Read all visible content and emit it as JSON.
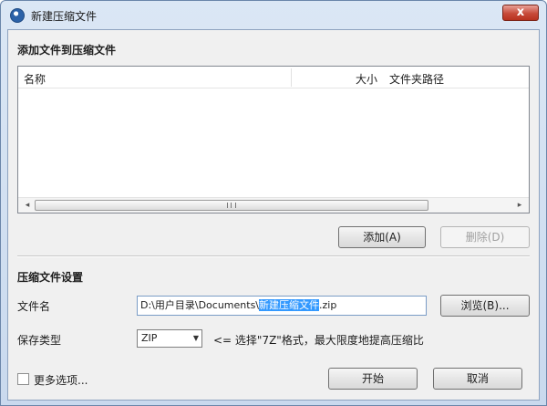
{
  "window": {
    "title": "新建压缩文件",
    "close_glyph": "x"
  },
  "add_section": {
    "heading": "添加文件到压缩文件",
    "columns": {
      "name": "名称",
      "size": "大小",
      "path": "文件夹路径"
    },
    "scroll_left": "◂",
    "scroll_right": "▸",
    "add_button": "添加(A)",
    "delete_button": "删除(D)"
  },
  "settings_section": {
    "heading": "压缩文件设置",
    "filename_label": "文件名",
    "filename_prefix": "D:\\用户目录\\Documents\\",
    "filename_selected": "新建压缩文件",
    "filename_suffix": ".zip",
    "browse_button": "浏览(B)...",
    "save_type_label": "保存类型",
    "save_type_value": "ZIP",
    "save_type_hint": "<= 选择\"7Z\"格式，最大限度地提高压缩比"
  },
  "footer": {
    "more_options_label": "更多选项...",
    "more_options_checked": false,
    "start_button": "开始",
    "cancel_button": "取消"
  },
  "colors": {
    "selection": "#3399ff",
    "close_button": "#c74a39"
  }
}
